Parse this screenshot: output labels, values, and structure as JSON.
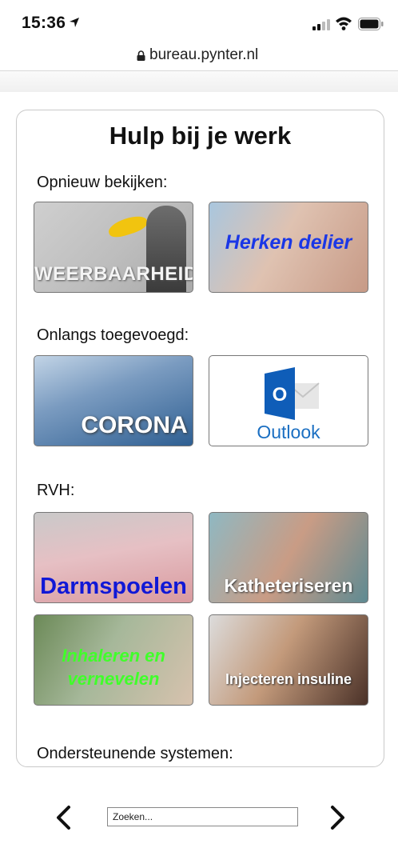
{
  "status_bar": {
    "time": "15:36"
  },
  "browser": {
    "url": "bureau.pynter.nl"
  },
  "page": {
    "title": "Hulp bij je werk",
    "sections": [
      {
        "label": "Opnieuw bekijken:"
      },
      {
        "label": "Onlangs toegevoegd:"
      },
      {
        "label": "RVH:"
      },
      {
        "label": "Ondersteunende systemen:"
      }
    ],
    "tiles": {
      "weerbaarheid": "WEERBAARHEID",
      "delier": "Herken delier",
      "corona": "CORONA",
      "outlook": "Outlook",
      "outlook_logo_letter": "O",
      "darmspoelen": "Darmspoelen",
      "katheteriseren": "Katheteriseren",
      "inhaleren": "Inhaleren en vernevelen",
      "insuline": "Injecteren insuline"
    }
  },
  "footer": {
    "search_placeholder": "Zoeken..."
  },
  "colors": {
    "delier_text": "#1a37e6",
    "darmspoelen_text": "#1018d6",
    "inhaleren_text": "#40ff2a",
    "outlook_blue": "#1b6fc2"
  }
}
